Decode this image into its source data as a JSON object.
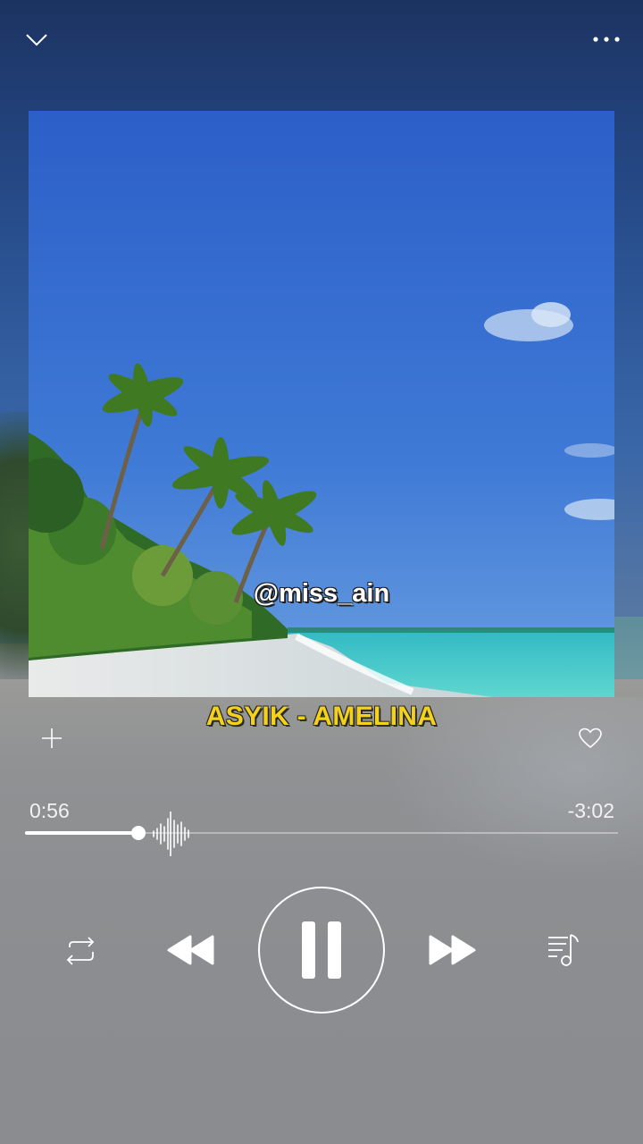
{
  "watermark": "@miss_ain",
  "song": {
    "title": "ASYIK - AMELINA"
  },
  "playback": {
    "elapsed": "0:56",
    "remaining": "-3:02",
    "progress_fraction": 0.192,
    "state": "playing"
  },
  "icons": {
    "collapse": "chevron-down-icon",
    "more": "more-dots-icon",
    "add": "plus-icon",
    "like": "heart-icon",
    "waveform": "waveform-icon",
    "repeat": "repeat-icon",
    "previous": "rewind-icon",
    "pause": "pause-icon",
    "next": "fast-forward-icon",
    "queue": "playlist-icon"
  },
  "colors": {
    "title": "#f4d21c",
    "controls": "#ffffff"
  }
}
